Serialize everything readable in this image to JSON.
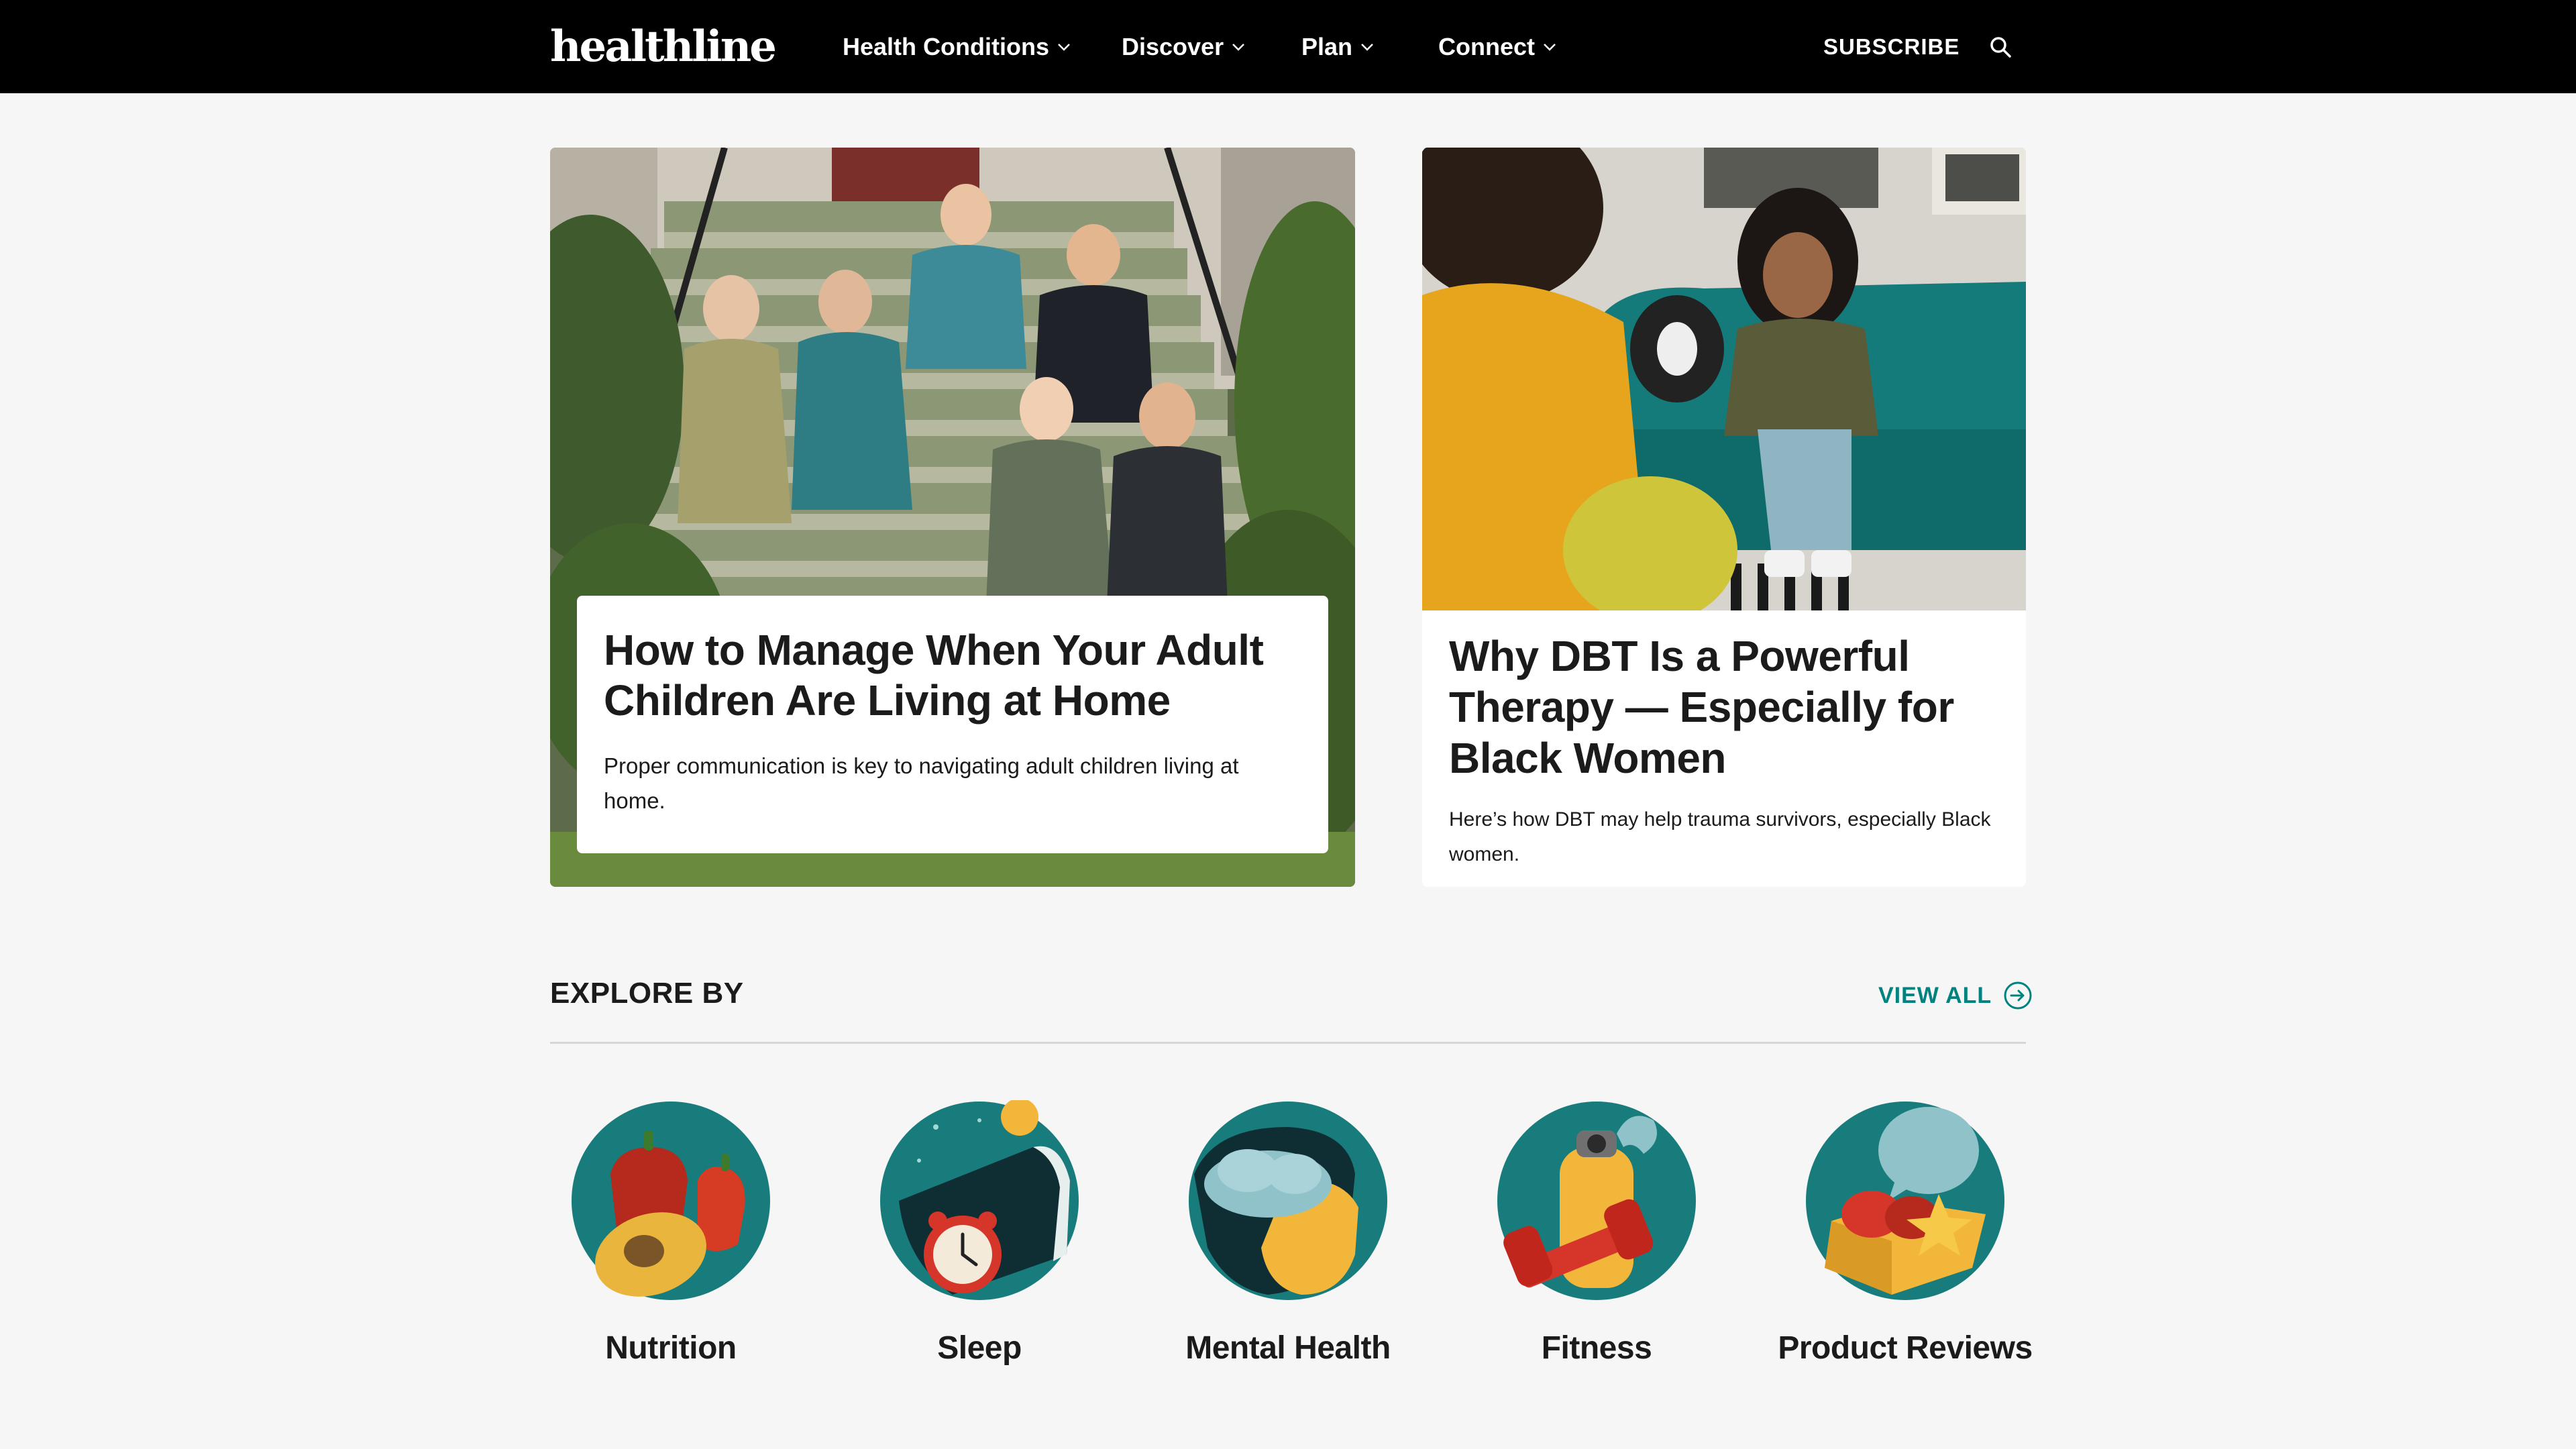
{
  "nav": {
    "logo": "healthline",
    "items": [
      {
        "label": "Health Conditions"
      },
      {
        "label": "Discover"
      },
      {
        "label": "Plan"
      },
      {
        "label": "Connect"
      }
    ],
    "subscribe": "SUBSCRIBE"
  },
  "featured": [
    {
      "title": "How to Manage When Your Adult Children Are Living at Home",
      "description": "Proper communication is key to navigating adult children living at home."
    },
    {
      "title": "Why DBT Is a Powerful Therapy — Especially for Black Women",
      "description": "Here’s how DBT may help trauma survivors, especially Black women."
    }
  ],
  "explore": {
    "heading": "EXPLORE BY",
    "view_all": "VIEW ALL",
    "categories": [
      {
        "label": "Nutrition",
        "icon": "nutrition-icon"
      },
      {
        "label": "Sleep",
        "icon": "sleep-icon"
      },
      {
        "label": "Mental Health",
        "icon": "mental-health-icon"
      },
      {
        "label": "Fitness",
        "icon": "fitness-icon"
      },
      {
        "label": "Product Reviews",
        "icon": "product-reviews-icon"
      }
    ]
  },
  "colors": {
    "nav_bg": "#000000",
    "accent": "#00827f",
    "page_bg": "#f6f6f6",
    "icon_teal": "#187c7c"
  }
}
